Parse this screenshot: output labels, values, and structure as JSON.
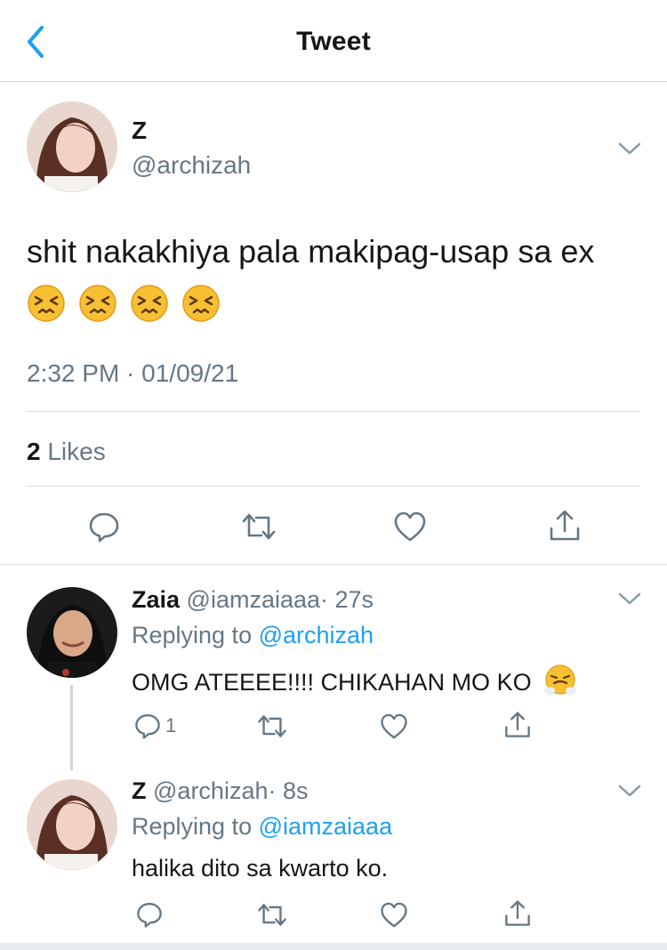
{
  "header": {
    "title": "Tweet"
  },
  "main_tweet": {
    "name": "Z",
    "handle": "@archizah",
    "text": "shit nakakhiya pala makipag-usap sa ex",
    "timestamp": "2:32 PM · 01/09/21",
    "likes_count": "2",
    "likes_label": "Likes"
  },
  "replies": [
    {
      "name": "Zaia",
      "handle": "@iamzaiaaa",
      "age": "· 27s",
      "replying_prefix": "Replying to",
      "replying_to": "@archizah",
      "text": "OMG ATEEEE!!!! CHIKAHAN MO KO",
      "reply_count": "1"
    },
    {
      "name": "Z",
      "handle": "@archizah",
      "age": "· 8s",
      "replying_prefix": "Replying to",
      "replying_to": "@iamzaiaaa",
      "text": "halika dito sa kwarto ko."
    }
  ],
  "colors": {
    "accent": "#1da1f2",
    "secondary_text": "#657786",
    "divider": "#d8dde1"
  },
  "icons": [
    "back-chevron-icon",
    "caret-down-icon",
    "reply-icon",
    "retweet-icon",
    "like-icon",
    "share-icon"
  ]
}
